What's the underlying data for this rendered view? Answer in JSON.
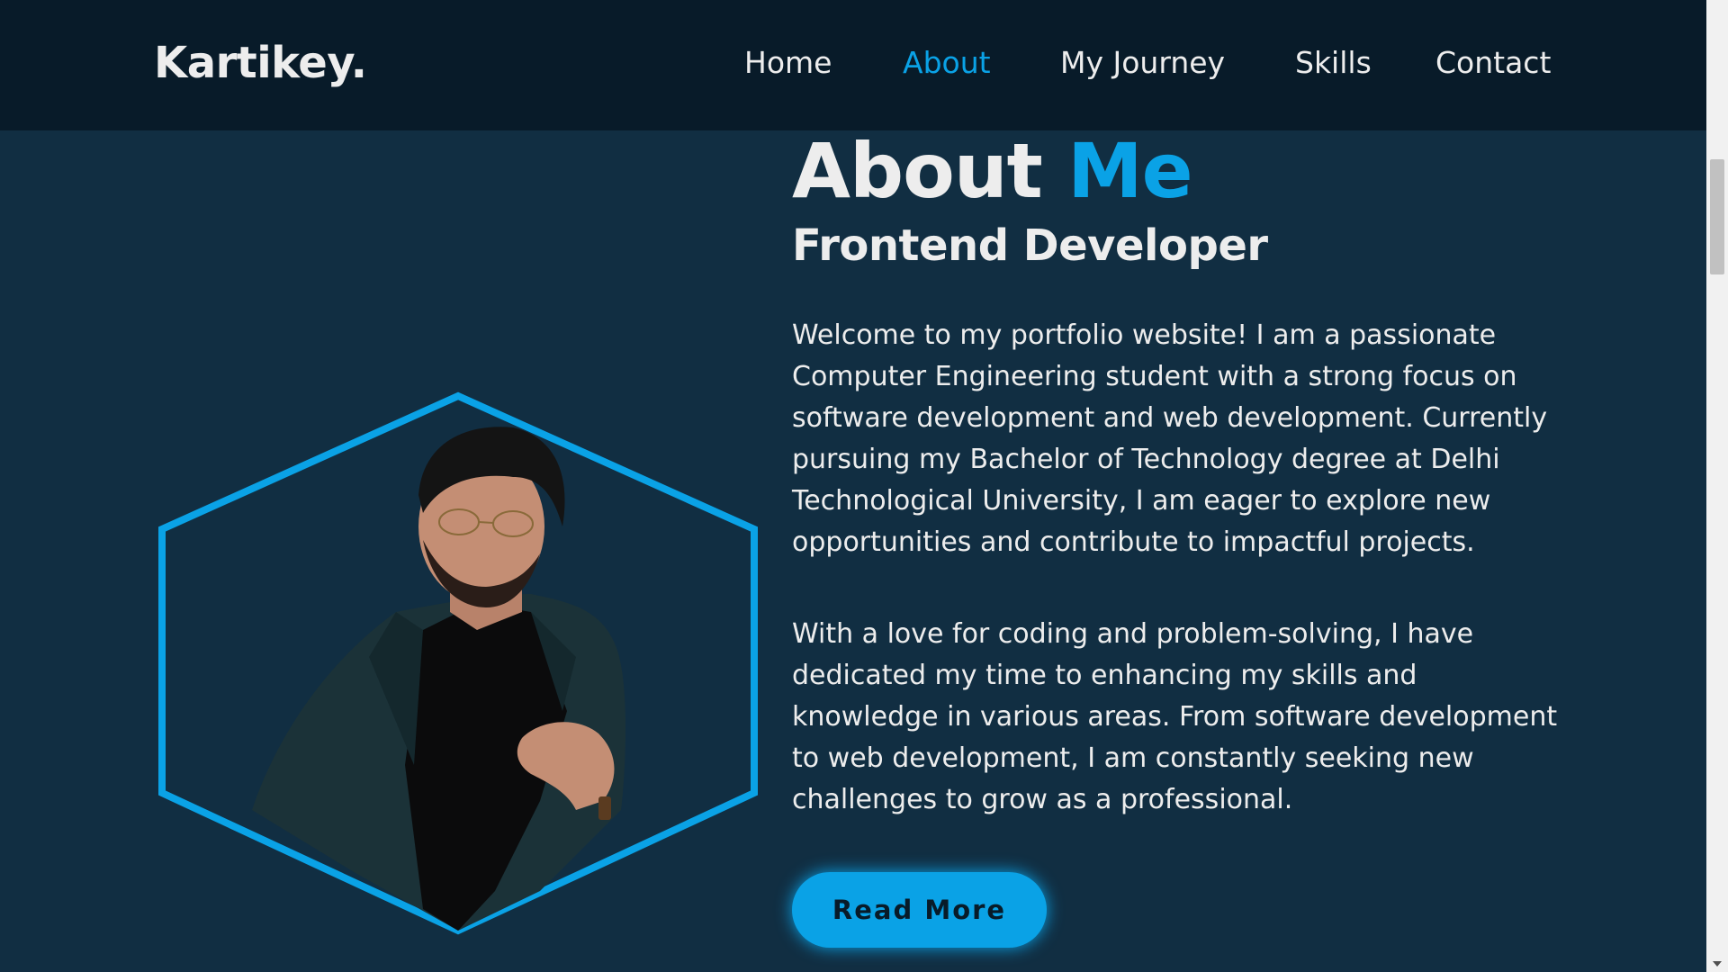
{
  "header": {
    "logo": "Kartikey.",
    "nav": [
      {
        "label": "Home"
      },
      {
        "label": "About",
        "active": true
      },
      {
        "label": "My Journey"
      },
      {
        "label": "Skills"
      },
      {
        "label": "Contact"
      }
    ]
  },
  "about": {
    "title_main": "About",
    "title_accent": "Me",
    "subtitle": "Frontend Developer",
    "paragraphs": [
      "Welcome to my portfolio website! I am a passionate Computer Engineering student with a strong focus on software development and web development. Currently pursuing my Bachelor of Technology degree at Delhi Technological University, I am eager to explore new opportunities and contribute to impactful projects.",
      "With a love for coding and problem-solving, I have dedicated my time to enhancing my skills and knowledge in various areas. From software development to web development, I am constantly seeking new challenges to grow as a professional."
    ],
    "button_label": "Read More"
  },
  "colors": {
    "accent": "#0aa2e6",
    "background": "#112e42",
    "header_bg": "#081b29",
    "text": "#ededed"
  },
  "icons": {
    "profile_photo": "portrait-photo-icon",
    "scroll_down": "chevron-down-icon"
  }
}
